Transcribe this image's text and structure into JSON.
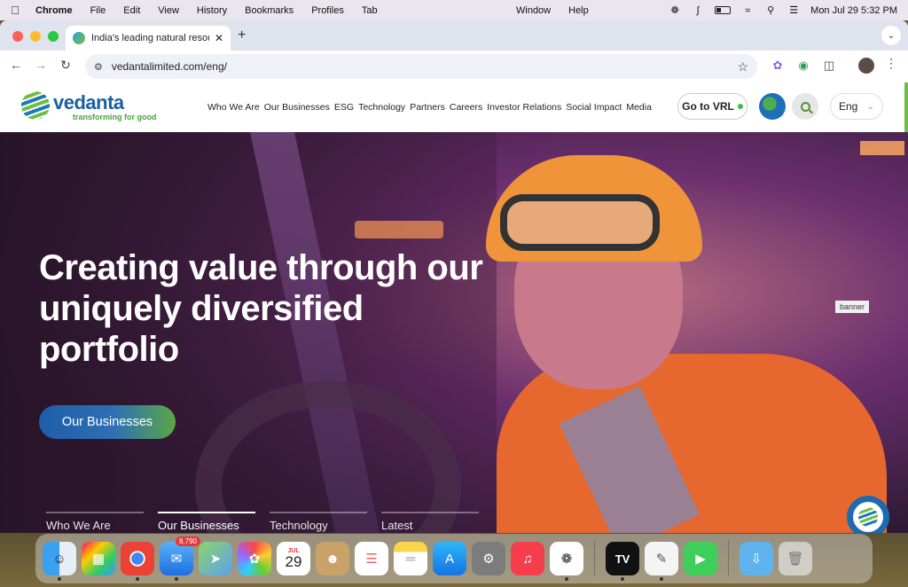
{
  "menubar": {
    "app": "Chrome",
    "left_items": [
      "File",
      "Edit",
      "View",
      "History",
      "Bookmarks",
      "Profiles",
      "Tab"
    ],
    "center_items": [
      "Window",
      "Help"
    ],
    "datetime": "Mon Jul 29  5:32 PM"
  },
  "browser": {
    "tab_title": "India's leading natural resour",
    "url": "vedantalimited.com/eng/"
  },
  "site": {
    "logo_word": "vedanta",
    "logo_tagline": "transforming for good",
    "nav": [
      "Who We Are",
      "Our Businesses",
      "ESG",
      "Technology",
      "Partners",
      "Careers",
      "Investor Relations",
      "Social Impact",
      "Media"
    ],
    "vrl_button": "Go to VRL",
    "language": "Eng"
  },
  "hero": {
    "title": "Creating value through our uniquely diversified portfolio",
    "cta": "Our Businesses",
    "banner_label": "banner",
    "tabs": [
      "Who We Are",
      "Our Businesses",
      "Technology",
      "Latest"
    ],
    "active_tab_index": 1
  },
  "dock": {
    "mail_badge": "8,790",
    "calendar_month": "JUL",
    "calendar_day": "29",
    "apps": [
      "finder-icon",
      "launchpad-icon",
      "chrome-icon",
      "mail-icon",
      "maps-icon",
      "photos-icon",
      "calendar-icon",
      "contacts-icon",
      "reminders-icon",
      "notes-icon",
      "app-store-icon",
      "system-settings-icon",
      "music-icon",
      "chatgpt-icon",
      "tradingview-icon",
      "textedit-icon",
      "facetime-icon",
      "downloads-icon",
      "trash-icon"
    ]
  },
  "colors": {
    "brand_blue": "#1a5f9e",
    "brand_green": "#6fbe44",
    "cta_gradient_start": "#1d5ea8"
  }
}
